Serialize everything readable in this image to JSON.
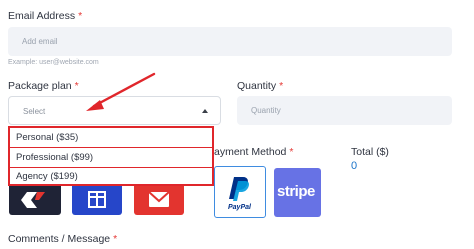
{
  "email": {
    "label": "Email Address",
    "required_mark": "*",
    "placeholder": "Add email",
    "hint": "Example: user@website.com"
  },
  "package": {
    "label": "Package plan",
    "required_mark": "*",
    "selected": "Select",
    "options": [
      "Personal ($35)",
      "Professional ($99)",
      "Agency ($199)"
    ]
  },
  "quantity": {
    "label": "Quantity",
    "required_mark": "*",
    "placeholder": "Quantity"
  },
  "payment": {
    "label": "Payment Method",
    "label_visible": "ayment Method",
    "required_mark": "*",
    "methods": [
      {
        "name": "PayPal",
        "text": "PayPal",
        "selected": true
      },
      {
        "name": "Stripe",
        "text": "stripe",
        "selected": false
      }
    ]
  },
  "total": {
    "label": "Total ($)",
    "value": "0"
  },
  "comments": {
    "label": "Comments / Message",
    "required_mark": "*"
  },
  "colors": {
    "highlight_red": "#e0262b",
    "required_red": "#e53935",
    "field_bg": "#f1f3f7",
    "total_blue": "#1a73c9",
    "stripe_purple": "#6772e5",
    "paypal_navy": "#003087",
    "paypal_blue": "#009cde"
  }
}
